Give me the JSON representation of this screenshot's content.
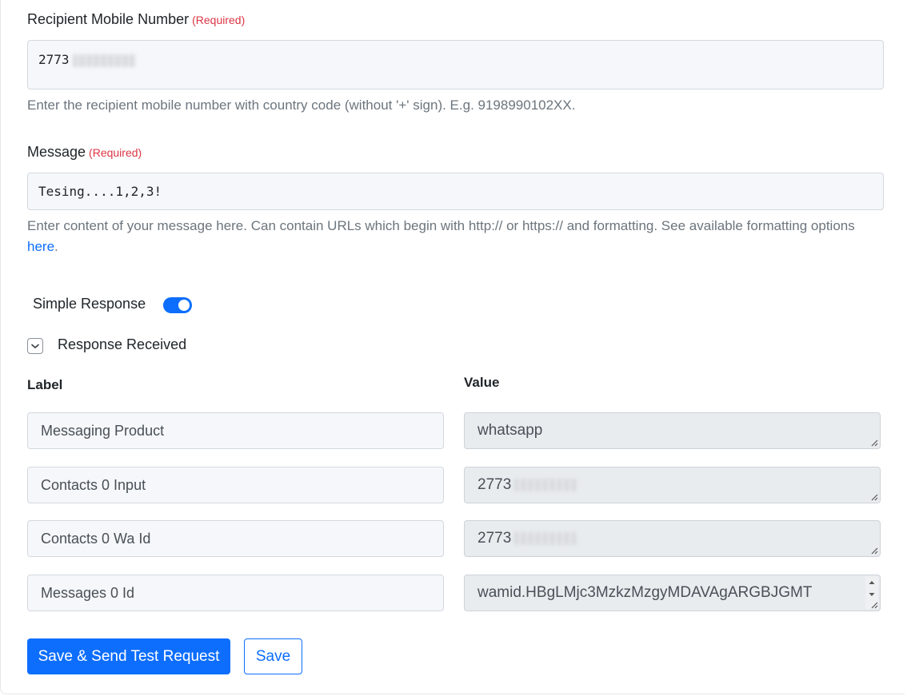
{
  "recipient": {
    "label": "Recipient Mobile Number",
    "required": "(Required)",
    "value": "2773",
    "help": "Enter the recipient mobile number with country code (without '+' sign). E.g. 9198990102XX."
  },
  "message": {
    "label": "Message",
    "required": "(Required)",
    "value": "Tesing....1,2,3!",
    "help": "Enter content of your message here. Can contain URLs which begin with http:// or https:// and formatting. See available formatting options",
    "help_link": "here",
    "help_end": "."
  },
  "simple_response": {
    "label": "Simple Response",
    "enabled": true
  },
  "response_received": {
    "label": "Response Received",
    "label_column": "Label",
    "value_column": "Value",
    "rows": [
      {
        "label": "Messaging Product",
        "value": "whatsapp"
      },
      {
        "label": "Contacts 0 Input",
        "value": "2773"
      },
      {
        "label": "Contacts 0 Wa Id",
        "value": "2773"
      },
      {
        "label": "Messages 0 Id",
        "value": "wamid.HBgLMjc3MzkzMzgyMDAVAgARGBJGMT"
      }
    ]
  },
  "buttons": {
    "save_send": "Save & Send Test Request",
    "save": "Save"
  },
  "colors": {
    "primary": "#0d6efd",
    "required": "#dc3545"
  }
}
